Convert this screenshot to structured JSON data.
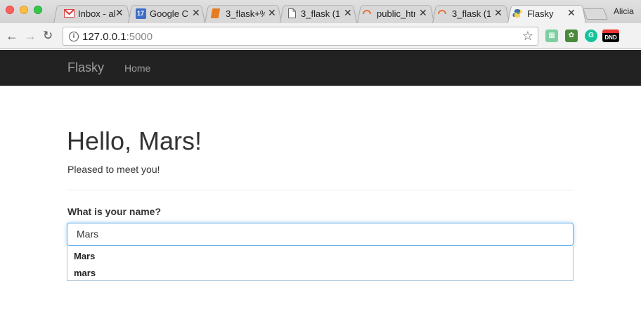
{
  "browser": {
    "tabs": [
      {
        "title": "Inbox - al",
        "icon": "gmail-icon",
        "active": false
      },
      {
        "title": "Google C",
        "icon": "calendar-icon",
        "active": false
      },
      {
        "title": "3_flask+%",
        "icon": "notebook-icon",
        "active": false
      },
      {
        "title": "3_flask (1",
        "icon": "document-icon",
        "active": false
      },
      {
        "title": "public_htr",
        "icon": "loading-icon",
        "active": false
      },
      {
        "title": "3_flask (1",
        "icon": "loading-icon",
        "active": false
      },
      {
        "title": "Flasky",
        "icon": "python-icon",
        "active": true
      }
    ],
    "calendar_day": "17",
    "profile_name": "Alicia",
    "url_host": "127.0.0.1",
    "url_port": ":5000",
    "extensions": [
      "extension-icon",
      "plant-icon",
      "grammarly-icon",
      "dnd-icon"
    ],
    "dnd_label": "DND",
    "grammarly_label": "G"
  },
  "page": {
    "brand": "Flasky",
    "nav_home": "Home",
    "heading": "Hello, Mars!",
    "lead": "Pleased to meet you!",
    "form_label": "What is your name?",
    "name_value": "Mars",
    "autocomplete": [
      "Mars",
      "mars"
    ]
  },
  "colors": {
    "navbar": "#222222",
    "focus_border": "#66afe9",
    "text": "#333333"
  }
}
